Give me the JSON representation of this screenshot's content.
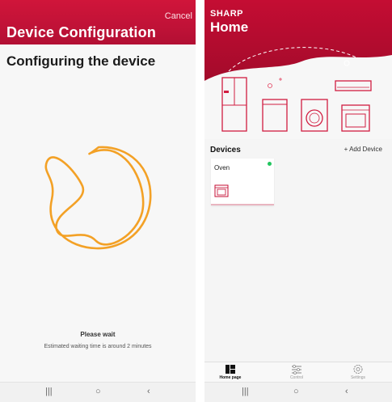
{
  "configuration": {
    "cancel": "Cancel",
    "title": "Device Configuration",
    "heading": "Configuring the device",
    "wait_title": "Please wait",
    "wait_subtitle": "Estimated waiting time is around 2 minutes",
    "accent_color": "#f3a126"
  },
  "home": {
    "brand": "SHARP",
    "title": "Home",
    "devices_label": "Devices",
    "add_device": "+ Add Device",
    "device_card": {
      "name": "Oven",
      "status_color": "#22c55e"
    },
    "tabs": [
      {
        "label": "Home page",
        "icon": "home-icon",
        "active": true
      },
      {
        "label": "Control",
        "icon": "sliders-icon",
        "active": false
      },
      {
        "label": "Settings",
        "icon": "gear-icon",
        "active": false
      }
    ],
    "brand_color": "#c40d33"
  },
  "system_nav": {
    "recent": "|||",
    "home": "○",
    "back": "‹"
  }
}
